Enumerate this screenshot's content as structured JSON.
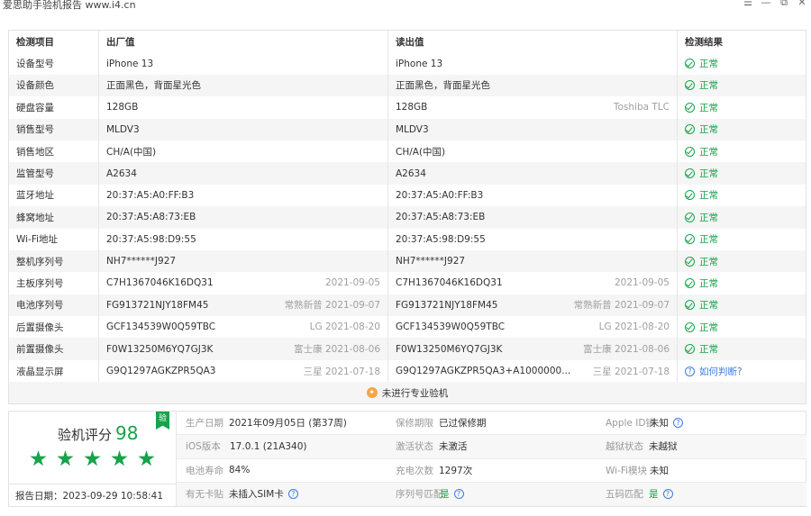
{
  "window": {
    "title": "爱思助手验机报告 www.i4.cn",
    "controls": [
      "☰",
      "—",
      "⧉",
      "✕"
    ]
  },
  "table": {
    "headers": [
      "检测项目",
      "出厂值",
      "读出值",
      "检测结果"
    ],
    "rows": [
      {
        "item": "设备型号",
        "factory": "iPhone 13",
        "factory_note": "",
        "read": "iPhone 13",
        "read_note": "",
        "result": "正常",
        "status": "ok"
      },
      {
        "item": "设备颜色",
        "factory": "正面黑色，背面星光色",
        "factory_note": "",
        "read": "正面黑色，背面星光色",
        "read_note": "",
        "result": "正常",
        "status": "ok"
      },
      {
        "item": "硬盘容量",
        "factory": "128GB",
        "factory_note": "",
        "read": "128GB",
        "read_note": "Toshiba TLC",
        "result": "正常",
        "status": "ok"
      },
      {
        "item": "销售型号",
        "factory": "MLDV3",
        "factory_note": "",
        "read": "MLDV3",
        "read_note": "",
        "result": "正常",
        "status": "ok"
      },
      {
        "item": "销售地区",
        "factory": "CH/A(中国)",
        "factory_note": "",
        "read": "CH/A(中国)",
        "read_note": "",
        "result": "正常",
        "status": "ok"
      },
      {
        "item": "监管型号",
        "factory": "A2634",
        "factory_note": "",
        "read": "A2634",
        "read_note": "",
        "result": "正常",
        "status": "ok"
      },
      {
        "item": "蓝牙地址",
        "factory": "20:37:A5:A0:FF:B3",
        "factory_note": "",
        "read": "20:37:A5:A0:FF:B3",
        "read_note": "",
        "result": "正常",
        "status": "ok"
      },
      {
        "item": "蜂窝地址",
        "factory": "20:37:A5:A8:73:EB",
        "factory_note": "",
        "read": "20:37:A5:A8:73:EB",
        "read_note": "",
        "result": "正常",
        "status": "ok"
      },
      {
        "item": "Wi-Fi地址",
        "factory": "20:37:A5:98:D9:55",
        "factory_note": "",
        "read": "20:37:A5:98:D9:55",
        "read_note": "",
        "result": "正常",
        "status": "ok"
      },
      {
        "item": "整机序列号",
        "factory": "NH7******J927",
        "factory_note": "",
        "read": "NH7******J927",
        "read_note": "",
        "result": "正常",
        "status": "ok"
      },
      {
        "item": "主板序列号",
        "factory": "C7H1367046K16DQ31",
        "factory_note": "2021-09-05",
        "read": "C7H1367046K16DQ31",
        "read_note": "2021-09-05",
        "result": "正常",
        "status": "ok"
      },
      {
        "item": "电池序列号",
        "factory": "FG913721NJY18FM45",
        "factory_note": "常熟新普 2021-09-07",
        "read": "FG913721NJY18FM45",
        "read_note": "常熟新普 2021-09-07",
        "result": "正常",
        "status": "ok"
      },
      {
        "item": "后置摄像头",
        "factory": "GCF134539W0Q59TBC",
        "factory_note": "LG 2021-08-20",
        "read": "GCF134539W0Q59TBC",
        "read_note": "LG 2021-08-20",
        "result": "正常",
        "status": "ok"
      },
      {
        "item": "前置摄像头",
        "factory": "F0W13250M6YQ7GJ3K",
        "factory_note": "富士康 2021-08-06",
        "read": "F0W13250M6YQ7GJ3K",
        "read_note": "富士康 2021-08-06",
        "result": "正常",
        "status": "ok"
      },
      {
        "item": "液晶显示屏",
        "factory": "G9Q1297AGKZPR5QA3",
        "factory_note": "三星 2021-07-18",
        "read": "G9Q1297AGKZPR5QA3+A1000000...",
        "read_note": "三星 2021-07-18",
        "result": "如何判断?",
        "status": "question"
      }
    ],
    "footer_text": "未进行专业验机"
  },
  "summary": {
    "score_label": "验机评分",
    "score": "98",
    "badge": "验",
    "stars": 5,
    "report_date": "报告日期：2023-09-29 10:58:41",
    "grid": [
      [
        {
          "label": "生产日期",
          "value": "2021年09月05日 (第37周)",
          "help": false,
          "green": false
        },
        {
          "label": "保修期限",
          "value": "已过保修期",
          "help": false,
          "green": false
        },
        {
          "label": "Apple ID锁",
          "value": "未知",
          "help": true,
          "green": false
        }
      ],
      [
        {
          "label": "iOS版本",
          "value": "17.0.1 (21A340)",
          "help": false,
          "green": false
        },
        {
          "label": "激活状态",
          "value": "未激活",
          "help": false,
          "green": false
        },
        {
          "label": "越狱状态",
          "value": "未越狱",
          "help": false,
          "green": false
        }
      ],
      [
        {
          "label": "电池寿命",
          "value": "84%",
          "help": false,
          "green": false
        },
        {
          "label": "充电次数",
          "value": "1297次",
          "help": false,
          "green": false
        },
        {
          "label": "Wi-Fi模块",
          "value": "未知",
          "help": false,
          "green": false
        }
      ],
      [
        {
          "label": "有无卡贴",
          "value": "未插入SIM卡",
          "help": true,
          "green": false
        },
        {
          "label": "序列号匹配",
          "value": "是",
          "help": true,
          "green": true
        },
        {
          "label": "五码匹配",
          "value": "是",
          "help": true,
          "green": true
        }
      ]
    ]
  },
  "colors": {
    "ok": "#16a34a",
    "link": "#3b7ddd",
    "accent_orange": "#f5a64a"
  }
}
